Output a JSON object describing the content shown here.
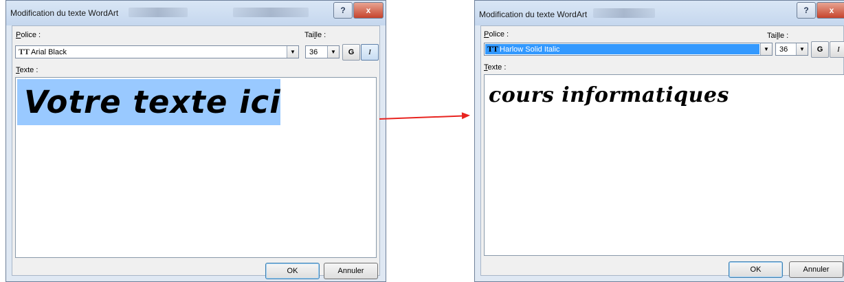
{
  "dialogs": [
    {
      "title": "Modification du texte WordArt",
      "help_glyph": "?",
      "close_glyph": "x",
      "font_label_key": "P",
      "font_label_rest": "olice :",
      "font_value": "Arial Black",
      "size_label_pre": "Tai",
      "size_label_key": "l",
      "size_label_post": "le :",
      "size_value": "36",
      "bold_label": "G",
      "italic_label": "I",
      "text_label_key": "T",
      "text_label_rest": "exte :",
      "text_value": "Votre texte ici",
      "ok_label": "OK",
      "cancel_label": "Annuler"
    },
    {
      "title": "Modification du texte WordArt",
      "help_glyph": "?",
      "close_glyph": "x",
      "font_label_key": "P",
      "font_label_rest": "olice :",
      "font_value": "Harlow Solid Italic",
      "size_label_pre": "Tai",
      "size_label_key": "l",
      "size_label_post": "le :",
      "size_value": "36",
      "bold_label": "G",
      "italic_label": "I",
      "text_label_key": "T",
      "text_label_rest": "exte :",
      "text_value": "cours informatiques",
      "ok_label": "OK",
      "cancel_label": "Annuler"
    }
  ],
  "icons": {
    "truetype": "TT",
    "dropdown": "▼"
  },
  "colors": {
    "arrow": "#e8231f",
    "selection": "#99c9ff",
    "font_highlight": "#3399ff"
  }
}
